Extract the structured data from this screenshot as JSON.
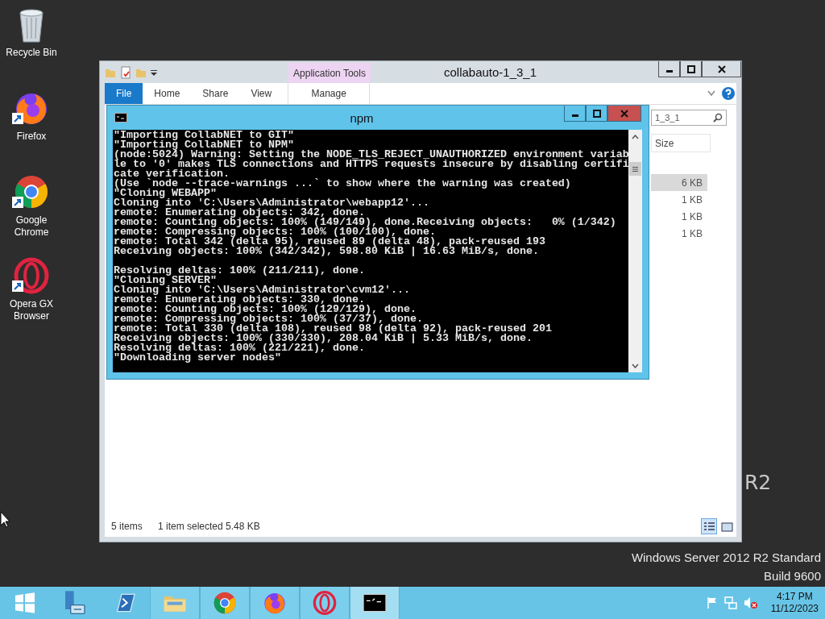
{
  "desktop": {
    "icons": [
      {
        "kind": "recycle_bin",
        "label": "Recycle Bin",
        "shortcut": false
      },
      {
        "kind": "firefox",
        "label": "Firefox",
        "shortcut": true
      },
      {
        "kind": "chrome",
        "label": "Google Chrome",
        "shortcut": true
      },
      {
        "kind": "opera",
        "label": "Opera GX Browser",
        "shortcut": true
      }
    ],
    "wallpaper_text": "R2",
    "edition": [
      "Windows Server 2012 R2 Standard",
      "Build 9600"
    ]
  },
  "explorer": {
    "title": "collabauto-1_3_1",
    "context_group": "Application Tools",
    "ribbon_tabs": [
      {
        "label": "File",
        "selected": true
      },
      {
        "label": "Home",
        "selected": false
      },
      {
        "label": "Share",
        "selected": false
      },
      {
        "label": "View",
        "selected": false
      },
      {
        "label": "Manage",
        "selected": false
      }
    ],
    "search_value": "1_3_1",
    "column_header": "Size",
    "rows": [
      {
        "size": "6 KB",
        "selected": true
      },
      {
        "size": "1 KB",
        "selected": false
      },
      {
        "size": "1 KB",
        "selected": false
      },
      {
        "size": "1 KB",
        "selected": false
      }
    ],
    "status": {
      "items": "5 items",
      "selection": "1 item selected  5.48 KB"
    },
    "views": [
      {
        "kind": "details",
        "selected": true
      },
      {
        "kind": "large_icons",
        "selected": false
      }
    ]
  },
  "console": {
    "title": "npm",
    "lines": [
      {
        "text": "\"Importing CollabNET to GIT\""
      },
      {
        "text": "\"Importing CollabNET to NPM\""
      },
      {
        "text": "(node:5024) Warning: Setting the NODE_TLS_REJECT_UNAUTHORIZED environment variab"
      },
      {
        "text": "le to '0' makes TLS connections and HTTPS requests insecure by disabling certifi"
      },
      {
        "text": "cate verification."
      },
      {
        "text": "(Use `node --trace-warnings ...` to show where the warning was created)"
      },
      {
        "text": "\"Cloning WEBAPP\""
      },
      {
        "text": "Cloning into 'C:\\Users\\Administrator\\webapp12'..."
      },
      {
        "text": "remote: Enumerating objects: 342, done."
      },
      {
        "text": "remote: Counting objects: 100% (149/149), done.Receiving objects:   0% (1/342)"
      },
      {
        "text": "remote: Compressing objects: 100% (100/100), done."
      },
      {
        "text": "remote: Total 342 (delta 95), reused 89 (delta 48), pack-reused 193"
      },
      {
        "text": "Receiving objects: 100% (342/342), 598.80 KiB | 16.63 MiB/s, done."
      },
      {
        "text": "Resolving deltas: 100% (211/211), done.",
        "blank_before": true
      },
      {
        "text": "\"Cloning SERVER\""
      },
      {
        "text": "Cloning into 'C:\\Users\\Administrator\\cvm12'..."
      },
      {
        "text": "remote: Enumerating objects: 330, done."
      },
      {
        "text": "remote: Counting objects: 100% (129/129), done."
      },
      {
        "text": "remote: Compressing objects: 100% (37/37), done."
      },
      {
        "text": "remote: Total 330 (delta 108), reused 98 (delta 92), pack-reused 201"
      },
      {
        "text": "Receiving objects: 100% (330/330), 208.04 KiB | 5.33 MiB/s, done."
      },
      {
        "text": "Resolving deltas: 100% (221/221), done."
      },
      {
        "text": "\"Downloading server nodes\""
      }
    ]
  },
  "taskbar": {
    "apps": [
      {
        "kind": "start",
        "running": false,
        "active": false
      },
      {
        "kind": "server_manager",
        "running": false,
        "active": false
      },
      {
        "kind": "powershell",
        "running": false,
        "active": false
      },
      {
        "kind": "explorer",
        "running": true,
        "active": false
      },
      {
        "kind": "chrome",
        "running": true,
        "active": false
      },
      {
        "kind": "firefox",
        "running": true,
        "active": false
      },
      {
        "kind": "opera",
        "running": true,
        "active": false
      },
      {
        "kind": "cmd",
        "running": true,
        "active": true
      }
    ],
    "time": "4:17 PM",
    "date": "11/12/2023"
  }
}
